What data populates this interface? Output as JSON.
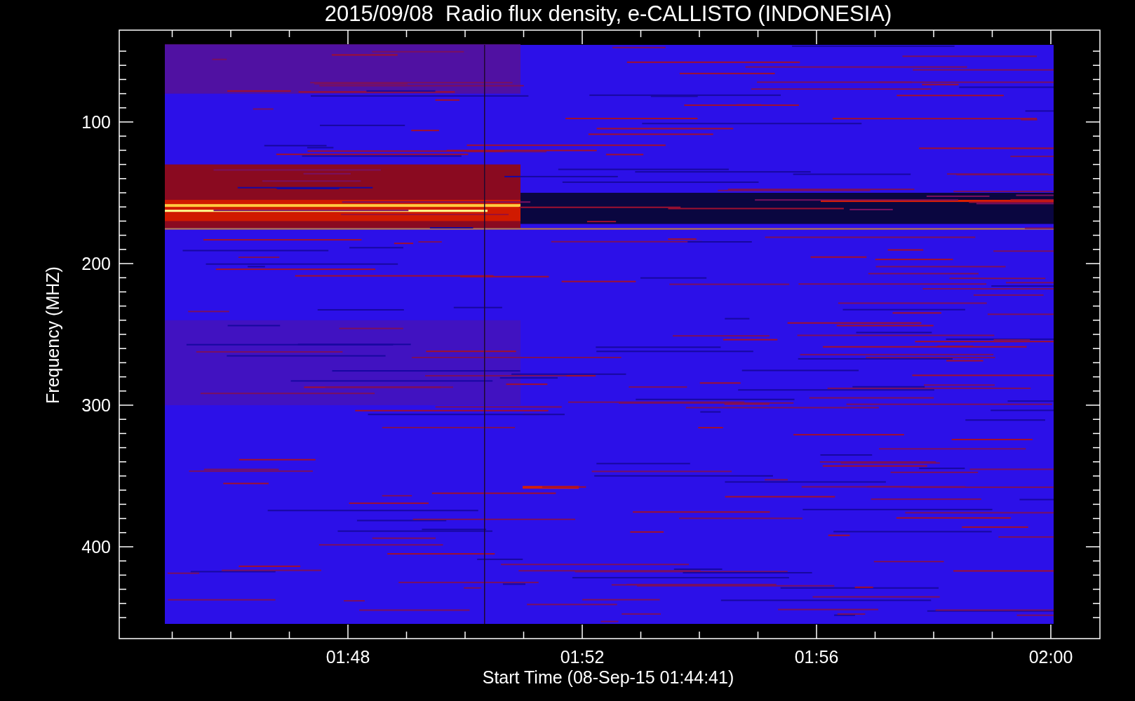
{
  "title": "2015/09/08  Radio flux density, e-CALLISTO (INDONESIA)",
  "y_axis": {
    "label": "Frequency (MHZ)",
    "ticks": [
      "100",
      "200",
      "300",
      "400"
    ]
  },
  "x_axis": {
    "label": "Start Time (08-Sep-15 01:44:41)",
    "ticks": [
      "01:48",
      "01:52",
      "01:56",
      "02:00"
    ]
  }
}
